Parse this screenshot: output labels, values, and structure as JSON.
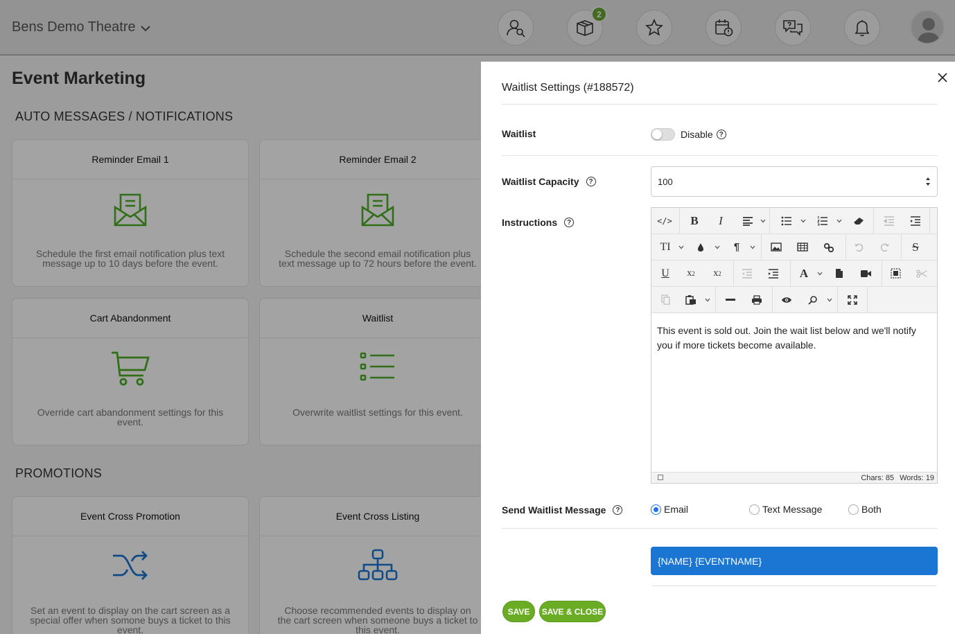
{
  "header": {
    "org_name": "Bens Demo Theatre",
    "icons": [
      "user-search-icon",
      "box-icon",
      "star-icon",
      "calendar-alert-icon",
      "chat-icon",
      "bell-icon"
    ],
    "box_badge": "2"
  },
  "page": {
    "title": "Event Marketing",
    "sections": {
      "auto_messages": "AUTO MESSAGES / NOTIFICATIONS",
      "promotions": "PROMOTIONS"
    },
    "cards": [
      {
        "title": "Reminder Email 1",
        "icon": "envelope-icon",
        "desc": "Schedule the first email notification plus text message up to 10 days before the event."
      },
      {
        "title": "Reminder Email 2",
        "icon": "envelope-icon",
        "desc": "Schedule the second email notification plus text message up to 72 hours before the event."
      },
      {
        "title": "Cart Abandonment",
        "icon": "cart-icon",
        "desc": "Override cart abandonment settings for this event."
      },
      {
        "title": "Waitlist",
        "icon": "list-icon",
        "desc": "Overwrite waitlist settings for this event."
      },
      {
        "title": "Event Cross Promotion",
        "icon": "shuffle-icon",
        "desc": "Set an event to display on the cart screen as a special offer when somone buys a ticket to this event."
      },
      {
        "title": "Event Cross Listing",
        "icon": "hierarchy-icon",
        "desc": "Choose recommended events to display on the cart screen when someone buys a ticket to this event."
      }
    ],
    "colors": {
      "green": "#4cae26",
      "blue": "#1b76d3"
    }
  },
  "modal": {
    "title": "Waitlist Settings (#188572)",
    "waitlist": {
      "label": "Waitlist",
      "toggle_text": "Disable",
      "enabled": false
    },
    "capacity": {
      "label": "Waitlist Capacity",
      "value": "100"
    },
    "instructions": {
      "label": "Instructions",
      "body": "This event is sold out. Join the wait list below and we'll notify you if more tickets become available.",
      "chars": "Chars: 85",
      "words": "Words: 19"
    },
    "send_message": {
      "label": "Send Waitlist Message",
      "options": [
        "Email",
        "Text Message",
        "Both"
      ],
      "selected": "Email"
    },
    "tags_bar": "{NAME} {EVENTNAME}",
    "buttons": {
      "save": "SAVE",
      "save_close": "SAVE & CLOSE"
    }
  }
}
